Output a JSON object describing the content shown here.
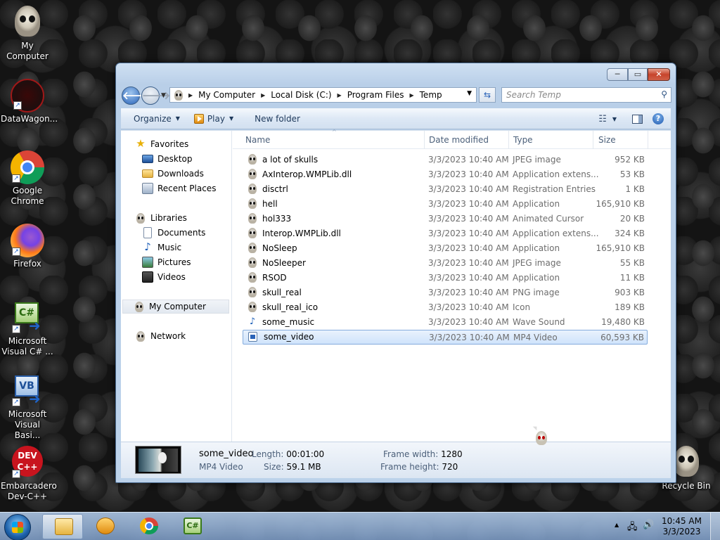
{
  "desktop": {
    "icons": [
      {
        "label": "My Computer"
      },
      {
        "label": "DataWagon..."
      },
      {
        "label": "Google Chrome"
      },
      {
        "label": "Firefox"
      },
      {
        "label": "Microsoft Visual C# ..."
      },
      {
        "label": "Microsoft Visual Basi..."
      },
      {
        "label": "Embarcadero Dev-C++"
      },
      {
        "label": "Recycle Bin"
      }
    ],
    "csharp_glyph": "C#",
    "vb_glyph": "VB",
    "dev_glyph": "DEV\nC++"
  },
  "window": {
    "caption": {
      "minimize": "─",
      "maximize": "▭",
      "close": "✕"
    },
    "address": {
      "crumbs": [
        "My Computer",
        "Local Disk (C:)",
        "Program Files",
        "Temp"
      ]
    },
    "search_placeholder": "Search Temp",
    "toolbar": {
      "organize": "Organize",
      "play": "Play",
      "new_folder": "New folder"
    },
    "nav": {
      "favorites": "Favorites",
      "desktop": "Desktop",
      "downloads": "Downloads",
      "recent": "Recent Places",
      "libraries": "Libraries",
      "documents": "Documents",
      "music": "Music",
      "pictures": "Pictures",
      "videos": "Videos",
      "computer": "My Computer",
      "network": "Network"
    },
    "columns": {
      "name": "Name",
      "date": "Date modified",
      "type": "Type",
      "size": "Size"
    },
    "files": [
      {
        "name": "a lot of skulls",
        "date": "3/3/2023 10:40 AM",
        "type": "JPEG image",
        "size": "952 KB",
        "icon": "skull"
      },
      {
        "name": "AxInterop.WMPLib.dll",
        "date": "3/3/2023 10:40 AM",
        "type": "Application extens...",
        "size": "53 KB",
        "icon": "skull"
      },
      {
        "name": "disctrl",
        "date": "3/3/2023 10:40 AM",
        "type": "Registration Entries",
        "size": "1 KB",
        "icon": "skull"
      },
      {
        "name": "hell",
        "date": "3/3/2023 10:40 AM",
        "type": "Application",
        "size": "165,910 KB",
        "icon": "skull"
      },
      {
        "name": "hol333",
        "date": "3/3/2023 10:40 AM",
        "type": "Animated Cursor",
        "size": "20 KB",
        "icon": "skull"
      },
      {
        "name": "Interop.WMPLib.dll",
        "date": "3/3/2023 10:40 AM",
        "type": "Application extens...",
        "size": "324 KB",
        "icon": "skull"
      },
      {
        "name": "NoSleep",
        "date": "3/3/2023 10:40 AM",
        "type": "Application",
        "size": "165,910 KB",
        "icon": "skull"
      },
      {
        "name": "NoSleeper",
        "date": "3/3/2023 10:40 AM",
        "type": "JPEG image",
        "size": "55 KB",
        "icon": "skull"
      },
      {
        "name": "RSOD",
        "date": "3/3/2023 10:40 AM",
        "type": "Application",
        "size": "11 KB",
        "icon": "skull"
      },
      {
        "name": "skull_real",
        "date": "3/3/2023 10:40 AM",
        "type": "PNG image",
        "size": "903 KB",
        "icon": "skull"
      },
      {
        "name": "skull_real_ico",
        "date": "3/3/2023 10:40 AM",
        "type": "Icon",
        "size": "189 KB",
        "icon": "skull"
      },
      {
        "name": "some_music",
        "date": "3/3/2023 10:40 AM",
        "type": "Wave Sound",
        "size": "19,480 KB",
        "icon": "music"
      },
      {
        "name": "some_video",
        "date": "3/3/2023 10:40 AM",
        "type": "MP4 Video",
        "size": "60,593 KB",
        "icon": "video"
      }
    ],
    "details": {
      "name": "some_video",
      "type": "MP4 Video",
      "length_label": "Length:",
      "length": "00:01:00",
      "size_label": "Size:",
      "size": "59.1 MB",
      "fw_label": "Frame width:",
      "fw": "1280",
      "fh_label": "Frame height:",
      "fh": "720"
    }
  },
  "taskbar": {
    "time": "10:45 AM",
    "date": "3/3/2023",
    "csharp_glyph": "C#"
  }
}
